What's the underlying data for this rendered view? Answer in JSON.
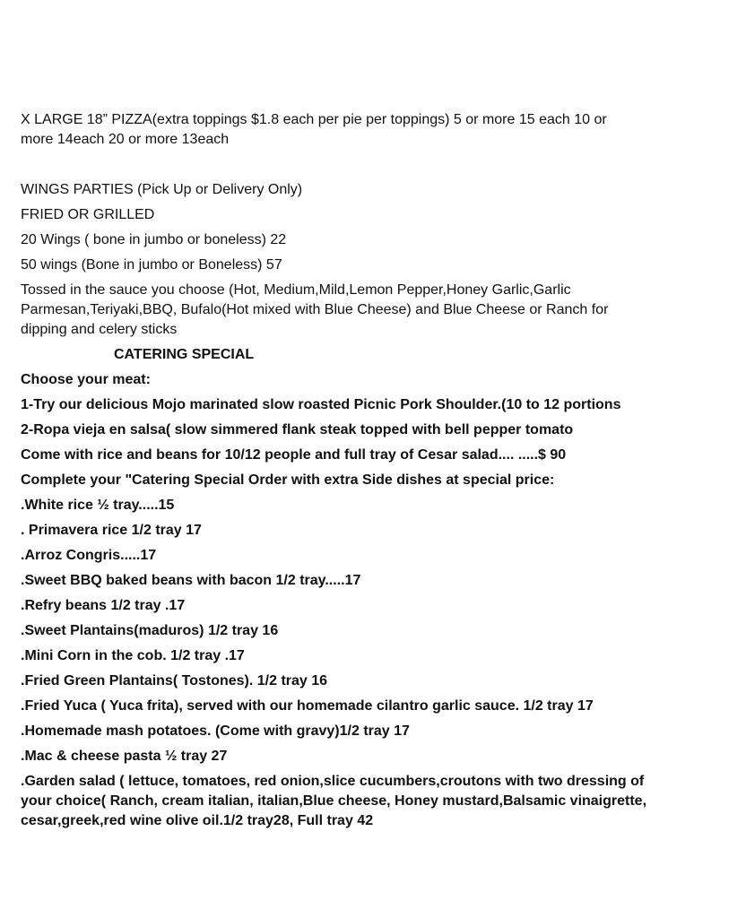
{
  "pizza": {
    "line1": "X LARGE 18”   PIZZA(extra toppings $1.8 each per pie per toppings) 5 or more 15 each     10 or",
    "line2": "more  14each    20 or more 13each"
  },
  "wings": {
    "title": "WINGS PARTIES (Pick Up or Delivery Only)",
    "style": "FRIED OR GRILLED",
    "item_20": "20 Wings ( bone in jumbo or boneless) 22",
    "item_50": "50 wings (Bone in jumbo or Boneless)  57",
    "sauce_line1": "Tossed in the sauce you choose (Hot, Medium,Mild,Lemon Pepper,Honey Garlic,Garlic",
    "sauce_line2": "Parmesan,Teriyaki,BBQ, Bufalo(Hot mixed with Blue Cheese) and Blue Cheese or Ranch for",
    "sauce_line3": "dipping and celery sticks"
  },
  "catering": {
    "heading": "CATERING SPECIAL",
    "choose_meat": "Choose your meat:",
    "option1": "1-Try our delicious Mojo marinated  slow roasted Picnic Pork Shoulder.(10 to 12  portions",
    "option2": "2-Ropa vieja en salsa( slow simmered flank steak topped  with bell pepper tomato",
    "includes": "Come with rice and beans for 10/12 people and full tray of Cesar salad.... .....$ 90",
    "complete": "Complete your \"Catering  Special Order with extra Side dishes at special price:"
  },
  "sides": [
    ".White rice ½ tray.....15",
    ". Primavera rice 1/2 tray 17",
    ".Arroz Congris.....17",
    ".Sweet BBQ baked  beans with bacon 1/2 tray.....17",
    ".Refry beans 1/2 tray .17",
    ".Sweet Plantains(maduros) 1/2 tray 16",
    ".Mini Corn in the cob. 1/2 tray .17",
    ".Fried Green Plantains( Tostones). 1/2 tray 16",
    ".Fried Yuca ( Yuca frita), served with our homemade cilantro garlic sauce. 1/2 tray 17",
    ".Homemade mash potatoes. (Come with gravy)1/2 tray  17",
    ".Mac & cheese pasta ½ tray 27"
  ],
  "salad": {
    "line1": ".Garden salad ( lettuce, tomatoes,  red onion,slice cucumbers,croutons with two dressing of",
    "line2": "your choice( Ranch, cream italian, italian,Blue cheese, Honey mustard,Balsamic vinaigrette,",
    "line3": "cesar,greek,red wine olive oil.1/2 tray28, Full tray 42"
  }
}
